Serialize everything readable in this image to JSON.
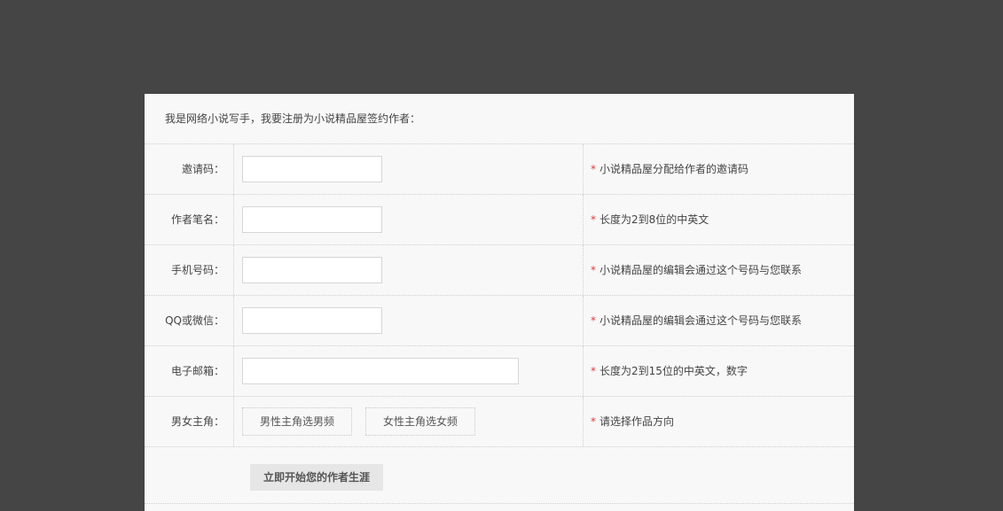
{
  "intro": "我是网络小说写手，我要注册为小说精品屋签约作者：",
  "rows": [
    {
      "label": "邀请码：",
      "hint": "小说精品屋分配给作者的邀请码"
    },
    {
      "label": "作者笔名：",
      "hint": "长度为2到8位的中英文"
    },
    {
      "label": "手机号码：",
      "hint": "小说精品屋的编辑会通过这个号码与您联系"
    },
    {
      "label": "QQ或微信：",
      "hint": "小说精品屋的编辑会通过这个号码与您联系"
    },
    {
      "label": "电子邮箱：",
      "hint": "长度为2到15位的中英文，数字"
    },
    {
      "label": "男女主角：",
      "hint": "请选择作品方向"
    }
  ],
  "gender_options": {
    "male": "男性主角选男频",
    "female": "女性主角选女频"
  },
  "required_mark": "*",
  "submit_label": "立即开始您的作者生涯",
  "colors": {
    "background": "#454545",
    "panel": "#f8f8f8",
    "required_star": "#e3393c"
  }
}
